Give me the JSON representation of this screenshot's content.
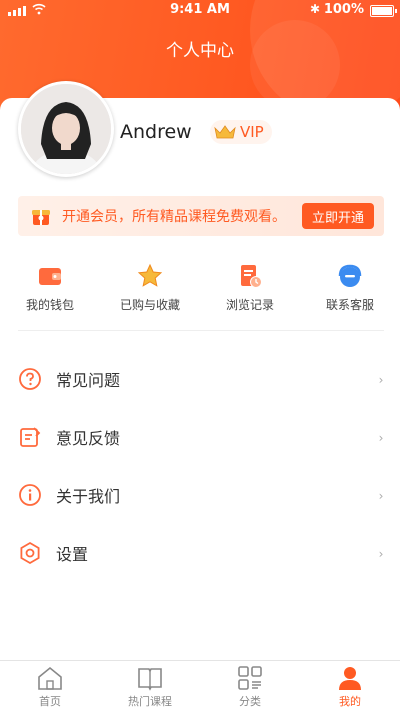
{
  "status_bar": {
    "time": "9:41 AM",
    "battery": "100%"
  },
  "header": {
    "title": "个人中心"
  },
  "profile": {
    "username": "Andrew",
    "badge": "VIP"
  },
  "banner": {
    "text": "开通会员，所有精品课程免费观看。",
    "button": "立即开通"
  },
  "quick_actions": [
    {
      "label": "我的钱包",
      "icon": "wallet-icon"
    },
    {
      "label": "已购与收藏",
      "icon": "star-icon"
    },
    {
      "label": "浏览记录",
      "icon": "history-icon"
    },
    {
      "label": "联系客服",
      "icon": "customer-service-icon"
    }
  ],
  "menu": [
    {
      "label": "常见问题",
      "icon": "question-icon"
    },
    {
      "label": "意见反馈",
      "icon": "feedback-icon"
    },
    {
      "label": "关于我们",
      "icon": "info-icon"
    },
    {
      "label": "设置",
      "icon": "settings-icon"
    }
  ],
  "tabbar": [
    {
      "label": "首页",
      "icon": "home-icon"
    },
    {
      "label": "热门课程",
      "icon": "book-icon"
    },
    {
      "label": "分类",
      "icon": "category-icon"
    },
    {
      "label": "我的",
      "icon": "user-icon"
    }
  ],
  "active_tab": "我的",
  "colors": {
    "accent": "#ff5a22",
    "header_start": "#ff6a2e",
    "header_end": "#ff4a1a"
  }
}
